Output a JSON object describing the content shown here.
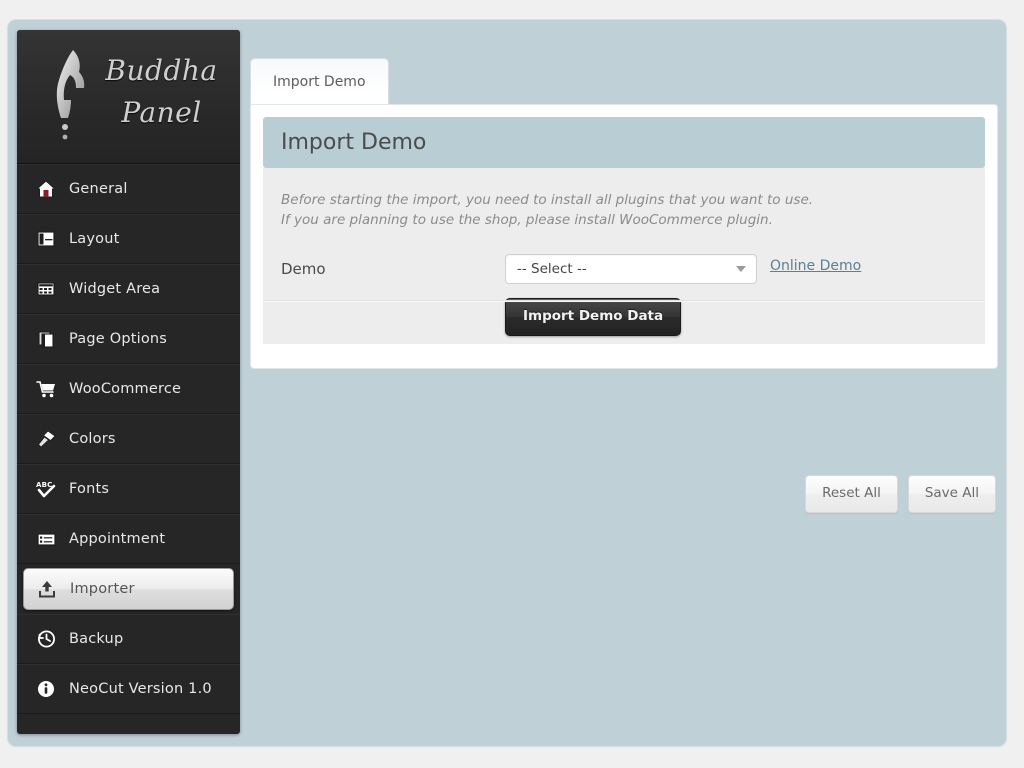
{
  "logo": {
    "line1": "Buddha",
    "line2": "Panel",
    "figure_icon": "buddha-silhouette-icon"
  },
  "sidebar": {
    "items": [
      {
        "label": "General",
        "icon": "home-icon",
        "active": false
      },
      {
        "label": "Layout",
        "icon": "layout-icon",
        "active": false
      },
      {
        "label": "Widget Area",
        "icon": "widget-grid-icon",
        "active": false
      },
      {
        "label": "Page Options",
        "icon": "book-icon",
        "active": false
      },
      {
        "label": "WooCommerce",
        "icon": "cart-icon",
        "active": false
      },
      {
        "label": "Colors",
        "icon": "brush-icon",
        "active": false
      },
      {
        "label": "Fonts",
        "icon": "abc-check-icon",
        "active": false
      },
      {
        "label": "Appointment",
        "icon": "form-list-icon",
        "active": false
      },
      {
        "label": "Importer",
        "icon": "upload-icon",
        "active": true
      },
      {
        "label": "Backup",
        "icon": "history-icon",
        "active": false
      },
      {
        "label": "NeoCut Version 1.0",
        "icon": "info-icon",
        "active": false
      }
    ]
  },
  "tabs": [
    {
      "label": "Import Demo",
      "active": true
    }
  ],
  "section": {
    "title": "Import Demo",
    "description_line1": "Before starting the import, you need to install all plugins that you want to use.",
    "description_line2": "If you are planning to use the shop, please install WooCommerce plugin.",
    "field_label": "Demo",
    "select_value": "-- Select --",
    "select_options": [
      "-- Select --"
    ],
    "online_demo_link": "Online Demo",
    "import_button": "Import Demo Data"
  },
  "footer": {
    "reset_label": "Reset All",
    "save_label": "Save All"
  },
  "colors": {
    "panel_background": "#bfd0d6",
    "page_background": "#f0f0f0",
    "sidebar_background": "#262626",
    "section_header": "#b9cdd4",
    "section_body": "#ededed",
    "link": "#5a7f96",
    "dark_button": "#2b2b2b"
  }
}
